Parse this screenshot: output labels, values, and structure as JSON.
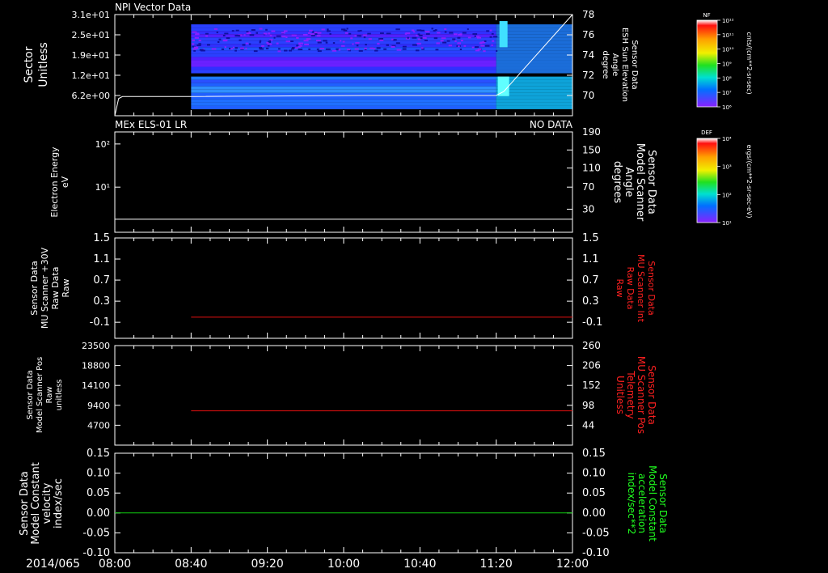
{
  "colors": {
    "background": "#000000",
    "frame": "#ffffff",
    "trace_white": "#ffffff",
    "trace_red": "#e01010",
    "trace_green": "#10d010",
    "label_red": "#ff2020",
    "label_green": "#20ff20"
  },
  "x_axis": {
    "date_label": "2014/065",
    "ticks": [
      "08:00",
      "08:40",
      "09:20",
      "10:00",
      "10:40",
      "11:20",
      "12:00"
    ]
  },
  "colorbars": [
    {
      "title": "NF",
      "unit": "cnts/(cm**2-sr-sec)",
      "tick_labels": [
        "10¹²",
        "10¹¹",
        "10¹⁰",
        "10⁹",
        "10⁸",
        "10⁷",
        "10⁶"
      ]
    },
    {
      "title": "DEF",
      "unit": "ergs/(cm**2-sr-sec-eV)",
      "tick_labels": [
        "10⁴",
        "10³",
        "10²",
        "10¹"
      ]
    }
  ],
  "chart_data": [
    {
      "type": "heatmap",
      "title": "NPI Vector Data",
      "ylabel": [
        "Sector",
        "Unitless"
      ],
      "y_tick_labels": [
        "3.1e+01",
        "2.5e+01",
        "1.9e+01",
        "1.2e+01",
        "6.2e+00"
      ],
      "right_ylabel": [
        "Sensor Data",
        "ESH Sun Elevation",
        "Angle",
        "degree"
      ],
      "right_tick_labels": [
        "78",
        "76",
        "74",
        "72",
        "70"
      ],
      "ylim": [
        0,
        31
      ],
      "right_ylim": [
        68,
        78
      ],
      "x_range": [
        "08:00",
        "12:00"
      ],
      "data_start": "08:40",
      "bands": [
        {
          "sector_range": [
            13,
            28
          ],
          "level": "high"
        },
        {
          "sector_range": [
            3,
            12
          ],
          "level": "high"
        }
      ],
      "overlay_line": {
        "name": "ESH Sun Elevation Angle",
        "x": [
          "08:00",
          "08:02",
          "08:04",
          "08:40",
          "10:10",
          "11:20",
          "11:24",
          "12:00"
        ],
        "y": [
          68,
          69.7,
          69.9,
          69.9,
          70.0,
          70.0,
          70.4,
          78
        ]
      }
    },
    {
      "type": "line",
      "title": "MEx ELS-01 LR",
      "annotation": "NO DATA",
      "ylabel": [
        "Electron Energy",
        "eV"
      ],
      "y_tick_labels": [
        "10²",
        "10¹"
      ],
      "yscale": "log",
      "right_ylabel": [
        "Sensor Data",
        "Model Scanner",
        "Angle",
        "degrees"
      ],
      "right_tick_labels": [
        "190",
        "150",
        "110",
        "70",
        "30"
      ],
      "right_ylim": [
        0,
        190
      ],
      "series": [
        {
          "color": "#ffffff",
          "x": [
            "08:00",
            "12:00"
          ],
          "y": [
            10,
            10
          ]
        }
      ]
    },
    {
      "type": "line",
      "ylabel": [
        "Sensor Data",
        "MU Scanner +30V",
        "Raw Data",
        "Raw"
      ],
      "y_tick_labels": [
        "1.5",
        "1.1",
        "0.7",
        "0.3",
        "-0.1"
      ],
      "ylim": [
        -0.4,
        1.5
      ],
      "right_ylabel": [
        "Sensor Data",
        "MU Scanner Int",
        "Raw Data",
        "Raw"
      ],
      "right_tick_labels": [
        "1.5",
        "1.1",
        "0.7",
        "0.3",
        "-0.1"
      ],
      "series": [
        {
          "color": "#e01010",
          "x": [
            "08:40",
            "12:00"
          ],
          "y": [
            0.0,
            0.0
          ]
        }
      ]
    },
    {
      "type": "line",
      "ylabel": [
        "Sensor Data",
        "Model Scanner Pos",
        "Raw",
        "unitless"
      ],
      "y_tick_labels": [
        "23500",
        "18800",
        "14100",
        "9400",
        "4700"
      ],
      "ylim": [
        0,
        23500
      ],
      "right_ylabel": [
        "Sensor Data",
        "MU Scanner Pos",
        "Telemetry",
        "Unitless"
      ],
      "right_tick_labels": [
        "260",
        "206",
        "152",
        "98",
        "44"
      ],
      "right_ylim": [
        0,
        260
      ],
      "series": [
        {
          "color": "#e01010",
          "x": [
            "08:40",
            "12:00"
          ],
          "y": [
            8100,
            8100
          ]
        }
      ]
    },
    {
      "type": "line",
      "ylabel": [
        "Sensor Data",
        "Model Constant",
        "velocity",
        "index/sec"
      ],
      "y_tick_labels": [
        "0.15",
        "0.10",
        "0.05",
        "0.00",
        "-0.05",
        "-0.10"
      ],
      "ylim": [
        -0.1,
        0.15
      ],
      "right_ylabel": [
        "Sensor Data",
        "Model Constant",
        "acceleration",
        "index/sec**2"
      ],
      "right_tick_labels": [
        "0.15",
        "0.10",
        "0.05",
        "0.00",
        "-0.05",
        "-0.10"
      ],
      "series": [
        {
          "color": "#10d010",
          "x": [
            "08:00",
            "12:00"
          ],
          "y": [
            0.0,
            0.0
          ]
        }
      ]
    }
  ]
}
